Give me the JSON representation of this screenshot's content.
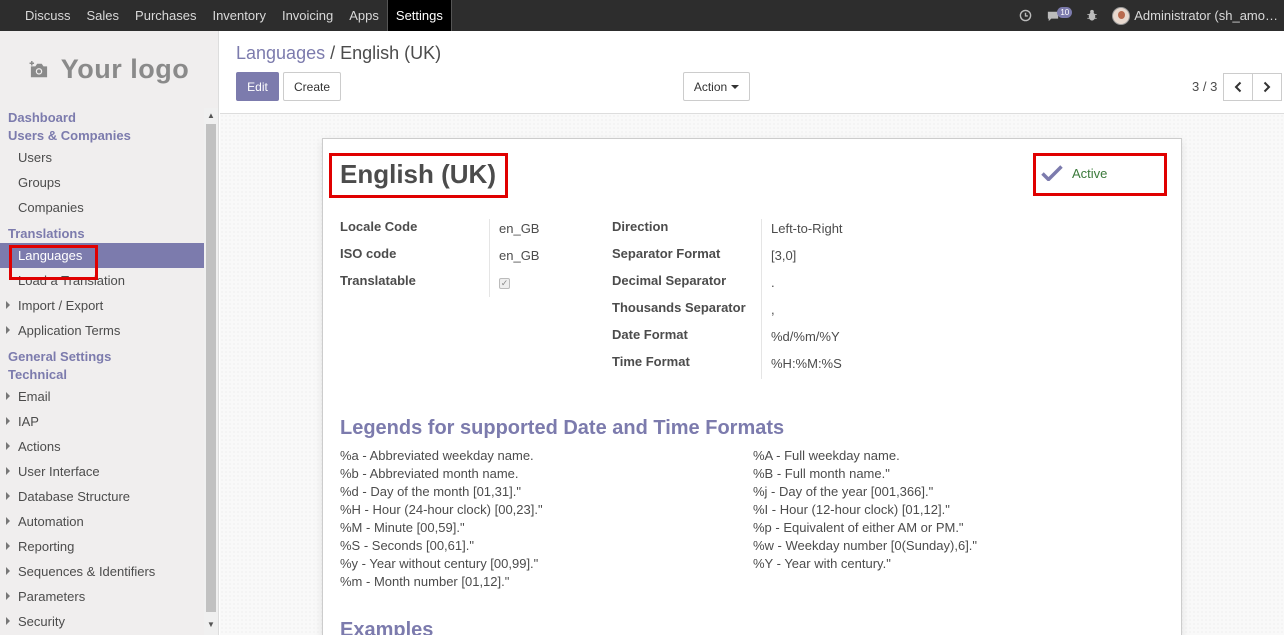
{
  "topbar": {
    "menu": [
      "Discuss",
      "Sales",
      "Purchases",
      "Inventory",
      "Invoicing",
      "Apps",
      "Settings"
    ],
    "active": "Settings",
    "message_count": "10",
    "user": "Administrator (sh_amo…"
  },
  "sidebar": {
    "logo_text": "Your logo",
    "sections": {
      "dashboard": "Dashboard",
      "users_companies": "Users & Companies",
      "users": "Users",
      "groups": "Groups",
      "companies": "Companies",
      "translations": "Translations",
      "languages": "Languages",
      "load_translation": "Load a Translation",
      "import_export": "Import / Export",
      "application_terms": "Application Terms",
      "general_settings": "General Settings",
      "technical": "Technical",
      "email": "Email",
      "iap": "IAP",
      "actions": "Actions",
      "user_interface": "User Interface",
      "database_structure": "Database Structure",
      "automation": "Automation",
      "reporting": "Reporting",
      "sequences": "Sequences & Identifiers",
      "parameters": "Parameters",
      "security": "Security"
    }
  },
  "control": {
    "breadcrumb_parent": "Languages",
    "breadcrumb_sep": "/",
    "breadcrumb_current": "English (UK)",
    "edit": "Edit",
    "create": "Create",
    "action": "Action",
    "pager": "3 / 3"
  },
  "form": {
    "title": "English (UK)",
    "active_label": "Active",
    "left_fields": [
      {
        "label": "Locale Code",
        "value": "en_GB"
      },
      {
        "label": "ISO code",
        "value": "en_GB"
      },
      {
        "label": "Translatable",
        "value": ""
      }
    ],
    "right_fields": [
      {
        "label": "Direction",
        "value": "Left-to-Right"
      },
      {
        "label": "Separator Format",
        "value": "[3,0]"
      },
      {
        "label": "Decimal Separator",
        "value": "."
      },
      {
        "label": "Thousands Separator",
        "value": ","
      },
      {
        "label": "Date Format",
        "value": "%d/%m/%Y"
      },
      {
        "label": "Time Format",
        "value": "%H:%M:%S"
      }
    ],
    "legend_title": "Legends for supported Date and Time Formats",
    "legend_left": [
      "%a - Abbreviated weekday name.",
      "%b - Abbreviated month name.",
      "%d - Day of the month [01,31].\"",
      "%H - Hour (24-hour clock) [00,23].\"",
      "%M - Minute [00,59].\"",
      "%S - Seconds [00,61].\"",
      "%y - Year without century [00,99].\"",
      "%m - Month number [01,12].\""
    ],
    "legend_right": [
      "%A - Full weekday name.",
      "%B - Full month name.\"",
      "%j - Day of the year [001,366].\"",
      "%I - Hour (12-hour clock) [01,12].\"",
      "%p - Equivalent of either AM or PM.\"",
      "%w - Weekday number [0(Sunday),6].\"",
      "%Y - Year with century.\""
    ],
    "examples_title": "Examples"
  },
  "colors": {
    "accent": "#7c7bad",
    "highlight": "#e00000",
    "navbar": "#2d2d2d"
  }
}
